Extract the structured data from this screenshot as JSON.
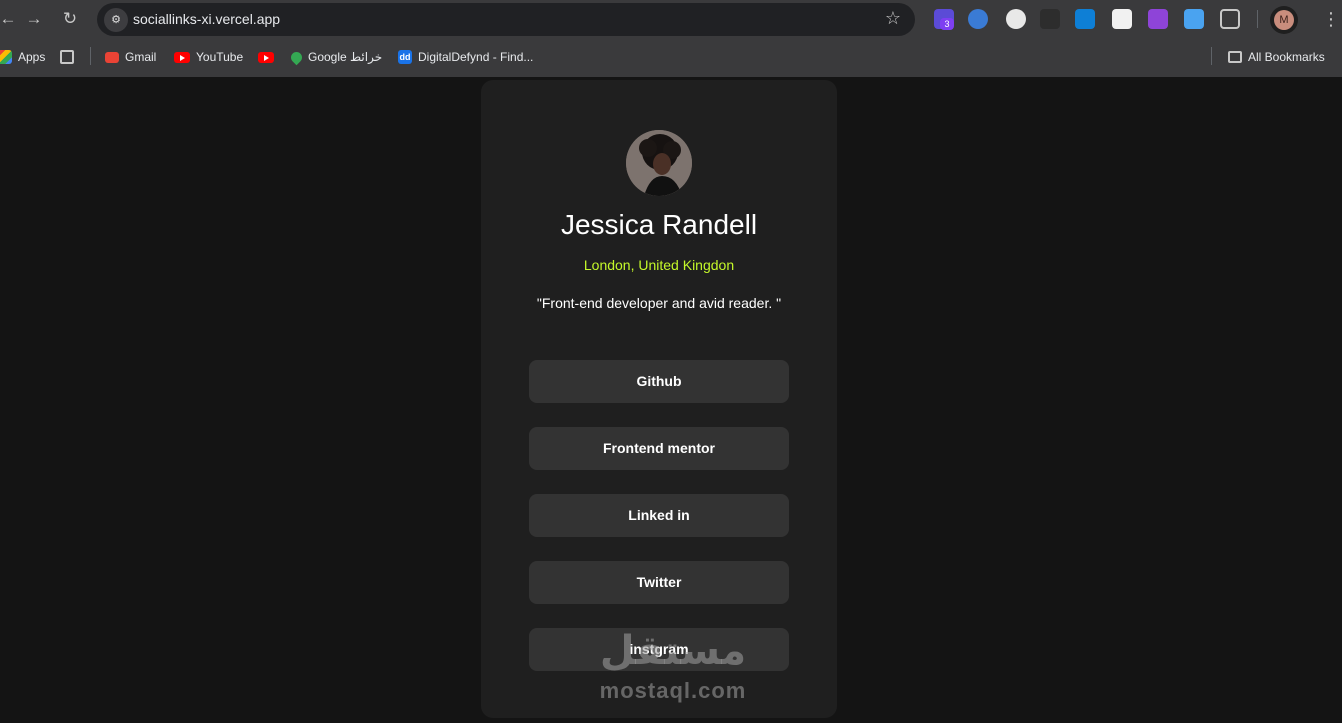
{
  "browser": {
    "url": "sociallinks-xi.vercel.app",
    "extension_badge": "3",
    "profile_initial": "M"
  },
  "bookmarks": {
    "items": [
      {
        "label": "Apps",
        "icon": "apps-grid-icon"
      },
      {
        "label": "",
        "icon": "grid-icon"
      },
      {
        "label": "Gmail",
        "icon": "gmail-icon"
      },
      {
        "label": "YouTube",
        "icon": "youtube-icon"
      },
      {
        "label": "",
        "icon": "youtube-icon"
      },
      {
        "label": "Google خرائط",
        "icon": "maps-pin-icon"
      },
      {
        "label": "DigitalDefynd - Find...",
        "icon": "dd-icon"
      }
    ],
    "all_bookmarks": "All Bookmarks"
  },
  "profile": {
    "name": "Jessica Randell",
    "location": "London, United Kingdon",
    "bio": "\"Front-end developer and avid reader. \""
  },
  "links": [
    {
      "label": "Github"
    },
    {
      "label": "Frontend mentor"
    },
    {
      "label": "Linked in"
    },
    {
      "label": "Twitter"
    },
    {
      "label": "instgram"
    }
  ],
  "watermark": {
    "arabic": "مستقل",
    "english": "mostaql.com"
  },
  "colors": {
    "accent": "#c4f82a",
    "card": "#1f1f1f",
    "button": "#333333",
    "background": "#141414"
  }
}
